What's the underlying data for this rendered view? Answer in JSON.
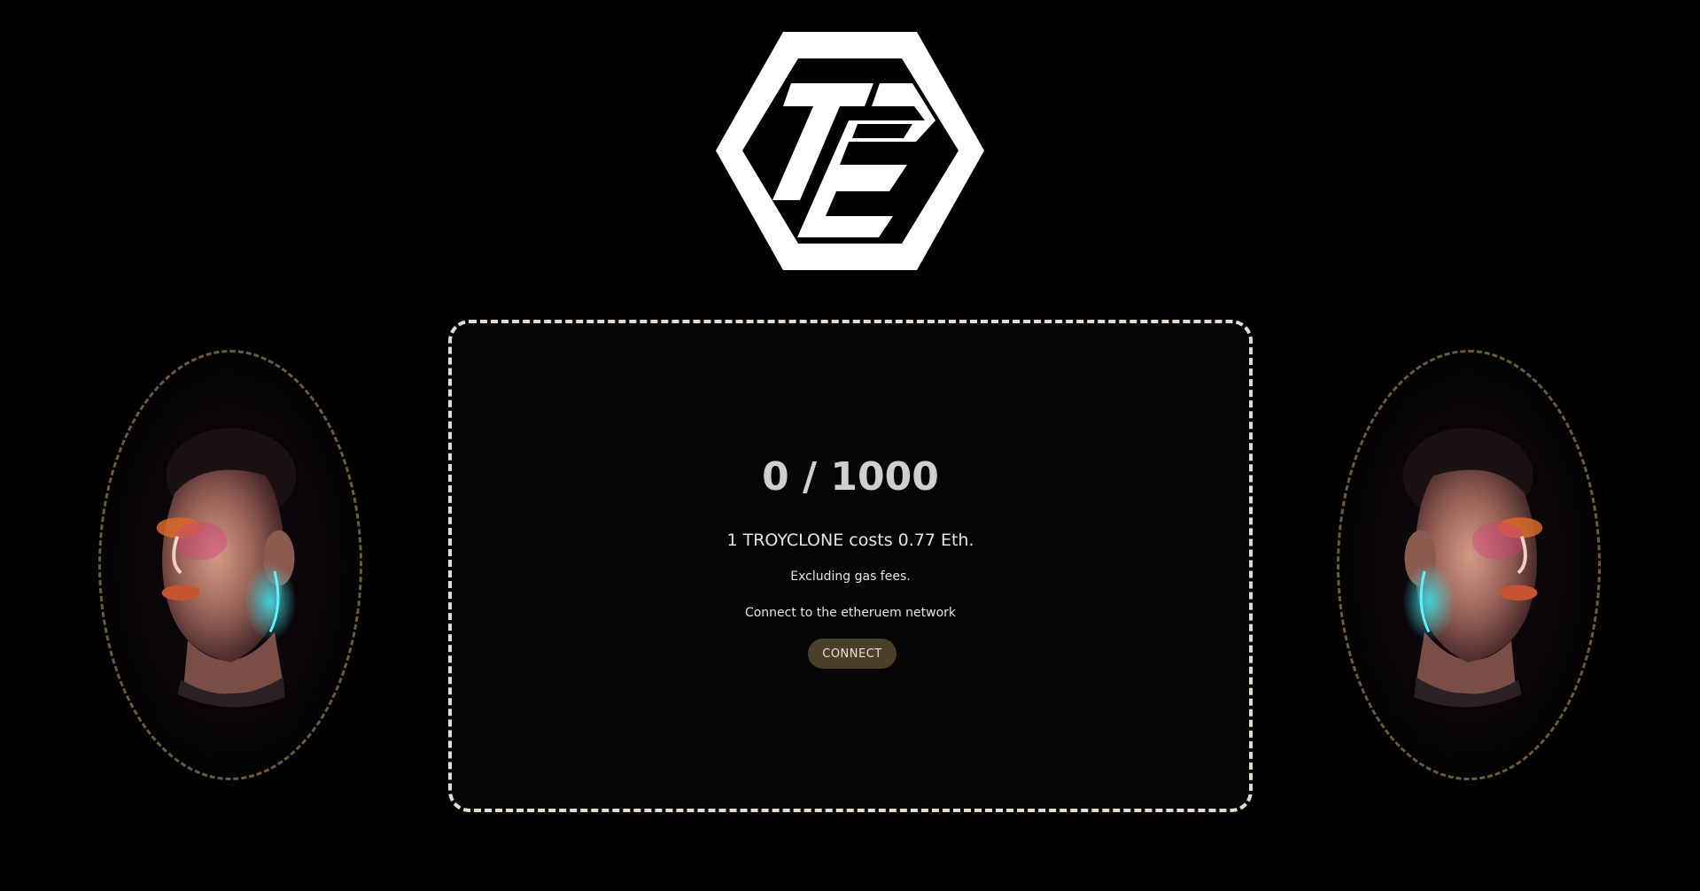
{
  "logo": {
    "text": "TE"
  },
  "mint": {
    "supply": "0 / 1000",
    "price": "1 TROYCLONE costs 0.77 Eth.",
    "gas_note": "Excluding gas fees.",
    "network_note": "Connect to the etheruem network",
    "connect_label": "CONNECT"
  },
  "colors": {
    "background": "#000000",
    "card_border": "#e2dccd",
    "portrait_border": "#6b5a3d",
    "button_bg": "#4a3f28"
  },
  "icons": {
    "logo": "hexagon-te-logo",
    "portrait": "cyberpunk-face-portrait"
  }
}
